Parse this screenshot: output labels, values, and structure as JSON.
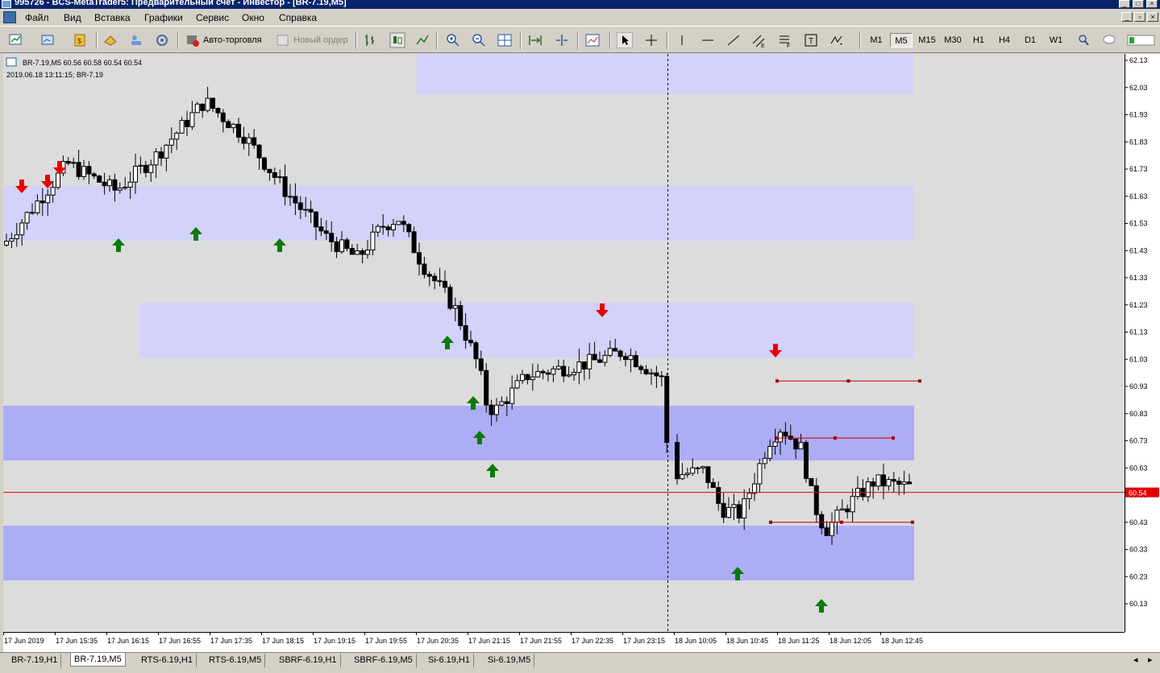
{
  "window": {
    "title": "995726 - BCS-MetaTrader5: Предварительный счет - Инвестор - [BR-7.19,M5]"
  },
  "menu": [
    "Файл",
    "Вид",
    "Вставка",
    "Графики",
    "Сервис",
    "Окно",
    "Справка"
  ],
  "toolbar": {
    "auto_trading": "Авто-торговля",
    "new_order": "Новый ордер",
    "timeframes": [
      "M1",
      "M5",
      "M15",
      "M30",
      "H1",
      "H4",
      "D1",
      "W1"
    ],
    "active_timeframe": "M5"
  },
  "chart": {
    "header_line1": "BR-7.19,M5  60.56 60.58 60.54 60.54",
    "header_line2": "2019.06.18 13:11:15; BR-7.19",
    "price_labels": [
      "62.13",
      "62.03",
      "61.93",
      "61.83",
      "61.73",
      "61.63",
      "61.53",
      "61.43",
      "61.33",
      "61.23",
      "61.13",
      "61.03",
      "60.93",
      "60.83",
      "60.73",
      "60.63",
      "60.53",
      "60.43",
      "60.33",
      "60.23",
      "60.13"
    ],
    "current_price": "60.54",
    "time_labels": [
      "17 Jun 2019",
      "17 Jun 15:35",
      "17 Jun 16:15",
      "17 Jun 16:55",
      "17 Jun 17:35",
      "17 Jun 18:15",
      "17 Jun 19:15",
      "17 Jun 19:55",
      "17 Jun 20:35",
      "17 Jun 21:15",
      "17 Jun 21:55",
      "17 Jun 22:35",
      "17 Jun 23:15",
      "18 Jun 10:05",
      "18 Jun 10:45",
      "18 Jun 11:25",
      "18 Jun 12:05",
      "18 Jun 12:45"
    ],
    "colors": {
      "zone_light": "#d2d2fa",
      "zone_dark": "#adadf5",
      "bull_body": "#ffffff",
      "bear_body": "#000000",
      "current_price_line": "#e00000",
      "up_arrow": "#0a7a0a",
      "down_arrow": "#e60000"
    }
  },
  "tabs": [
    "BR-7.19,H1",
    "BR-7.19,M5",
    "RTS-6.19,H1",
    "RTS-6.19,M5",
    "SBRF-6.19,H1",
    "SBRF-6.19,M5",
    "Si-6.19,H1",
    "Si-6.19,M5"
  ],
  "active_tab": "BR-7.19,M5"
}
